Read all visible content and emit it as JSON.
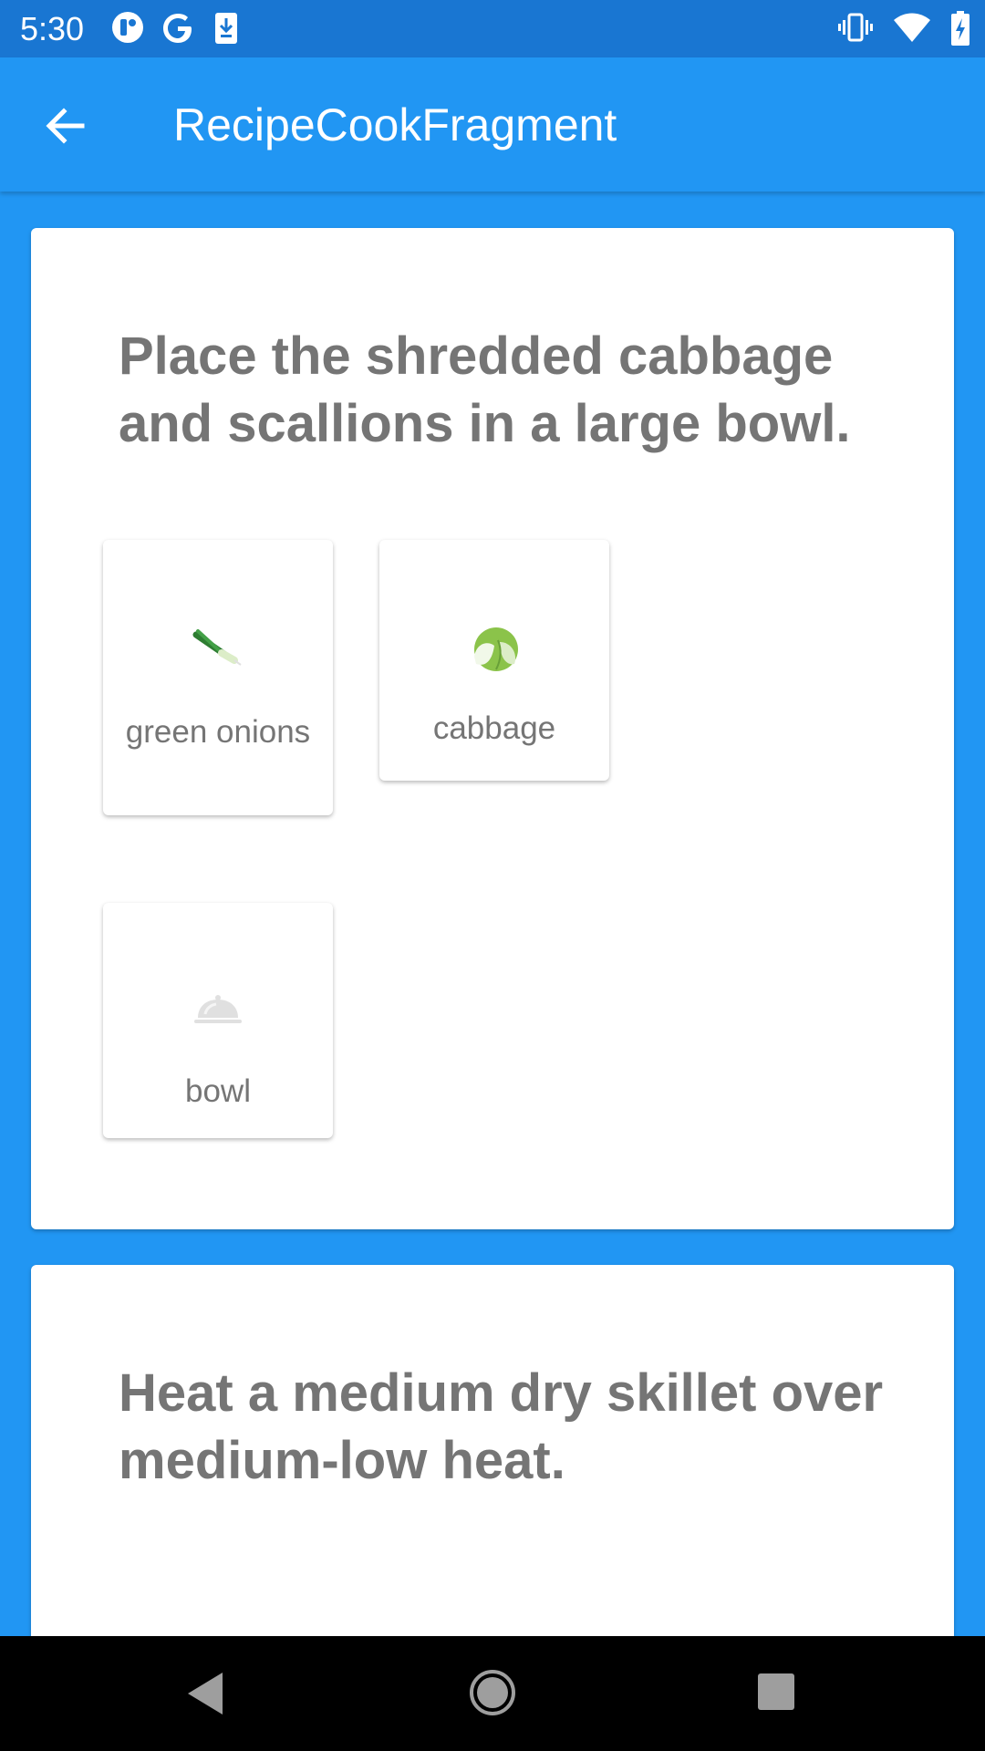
{
  "status_bar": {
    "time": "5:30",
    "left_icons": [
      "notification-app-icon",
      "google-icon",
      "download-icon"
    ],
    "right_icons": [
      "vibrate-icon",
      "wifi-icon",
      "battery-charging-icon"
    ]
  },
  "app_bar": {
    "title": "RecipeCookFragment",
    "back_icon": "arrow-back-icon"
  },
  "steps": [
    {
      "text": "Place the shredded cabbage and scallions in a large bowl.",
      "items": [
        {
          "label": "green onions",
          "icon": "green-onion-icon"
        },
        {
          "label": "cabbage",
          "icon": "cabbage-icon"
        },
        {
          "label": "bowl",
          "icon": "bowl-icon"
        }
      ]
    },
    {
      "text": "Heat a medium dry skillet over medium-low heat.",
      "items": []
    }
  ],
  "nav_bar": {
    "icons": [
      "nav-back-icon",
      "nav-home-icon",
      "nav-recents-icon"
    ]
  },
  "colors": {
    "primary": "#2196F3",
    "primary_dark": "#1976D2",
    "card_text": "#757575",
    "card_background": "#FFFFFF"
  }
}
